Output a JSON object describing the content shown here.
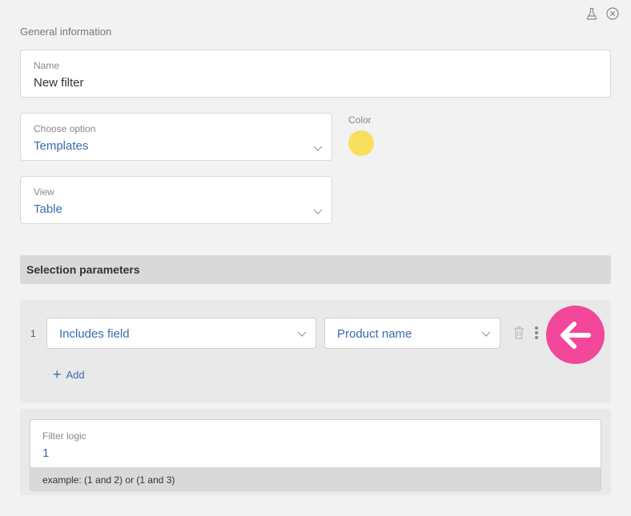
{
  "header": {
    "section_title": "General information",
    "icons": [
      "flask-icon",
      "close-circle-icon"
    ]
  },
  "name_field": {
    "label": "Name",
    "value": "New filter"
  },
  "option_field": {
    "label": "Choose option",
    "value": "Templates"
  },
  "color": {
    "label": "Color",
    "value": "#f8df5e"
  },
  "view_field": {
    "label": "View",
    "value": "Table"
  },
  "selection": {
    "title": "Selection parameters",
    "rows": [
      {
        "number": "1",
        "condition": "Includes field",
        "field": "Product name"
      }
    ],
    "add_label": "Add"
  },
  "filter_logic": {
    "label": "Filter logic",
    "value": "1",
    "hint": "example: (1 and 2) or (1 and 3)"
  },
  "colors": {
    "accent": "#3c6ab0",
    "back_button": "#f2479b",
    "header_bg": "#d9d9d9"
  }
}
